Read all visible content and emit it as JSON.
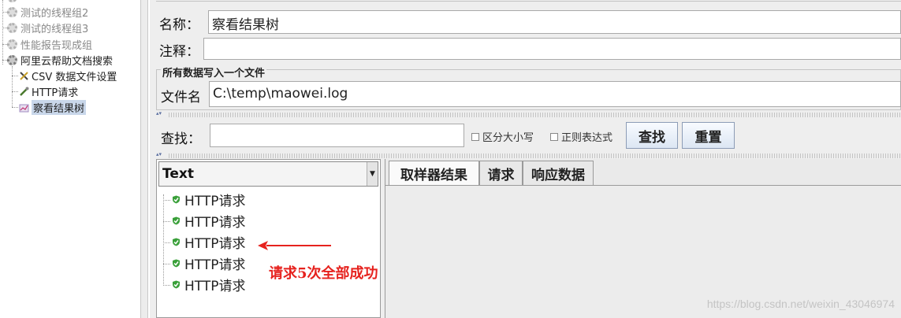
{
  "tree": {
    "items": [
      {
        "label": "测试的线程组2"
      },
      {
        "label": "测试的线程组3"
      },
      {
        "label": "性能报告现成组"
      },
      {
        "label": "阿里云帮助文档搜索"
      },
      {
        "label": "CSV 数据文件设置"
      },
      {
        "label": "HTTP请求"
      },
      {
        "label": "察看结果树"
      }
    ]
  },
  "form": {
    "name_label": "名称：",
    "name_value": "察看结果树",
    "comment_label": "注释：",
    "comment_value": "",
    "group_title": "所有数据写入一个文件",
    "file_label": "文件名",
    "file_value": "C:\\temp\\maowei.log"
  },
  "search": {
    "label": "查找：",
    "value": "",
    "case_label": "区分大小写",
    "regex_label": "正则表达式",
    "find_button": "查找",
    "reset_button": "重置"
  },
  "results": {
    "renderer": "Text",
    "items": [
      {
        "label": "HTTP请求",
        "status": "success"
      },
      {
        "label": "HTTP请求",
        "status": "success"
      },
      {
        "label": "HTTP请求",
        "status": "success"
      },
      {
        "label": "HTTP请求",
        "status": "success"
      },
      {
        "label": "HTTP请求",
        "status": "success"
      }
    ]
  },
  "tabs": [
    {
      "label": "取样器结果",
      "active": true
    },
    {
      "label": "请求",
      "active": false
    },
    {
      "label": "响应数据",
      "active": false
    }
  ],
  "annotation": "请求5次全部成功",
  "watermark": "https://blog.csdn.net/weixin_43046974",
  "colors": {
    "annotation": "#e6221e",
    "success": "#3aa03a",
    "selection": "#c9d7ea"
  }
}
